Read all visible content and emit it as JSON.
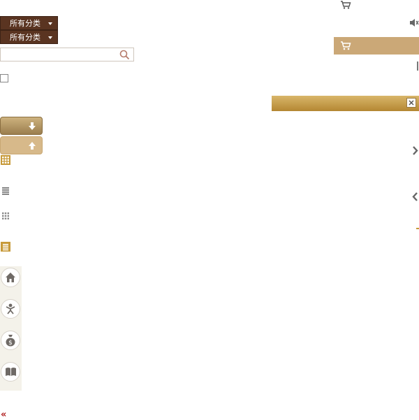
{
  "category_selector": {
    "primary_label": "所有分类",
    "secondary_label": "所有分类"
  },
  "search": {
    "placeholder": "",
    "icon": "search-icon"
  },
  "sort_buttons": {
    "down_icon": "arrow-down-icon",
    "up_icon": "arrow-up-icon"
  },
  "view_modes": [
    "grid-view-active-icon",
    "list-view-icon",
    "grid-view-icon",
    "list-view-active-icon"
  ],
  "side_nav": [
    "home-icon",
    "user-icon",
    "money-bag-icon",
    "book-icon"
  ],
  "collapse_label": "«",
  "header": {
    "cart_icon": "cart-icon",
    "speaker_icon": "speaker-icon"
  },
  "colors": {
    "brand_dark": "#5a3421",
    "gold": "#c8a25a",
    "tan": "#cba877",
    "collapse_red": "#b01e1e"
  }
}
